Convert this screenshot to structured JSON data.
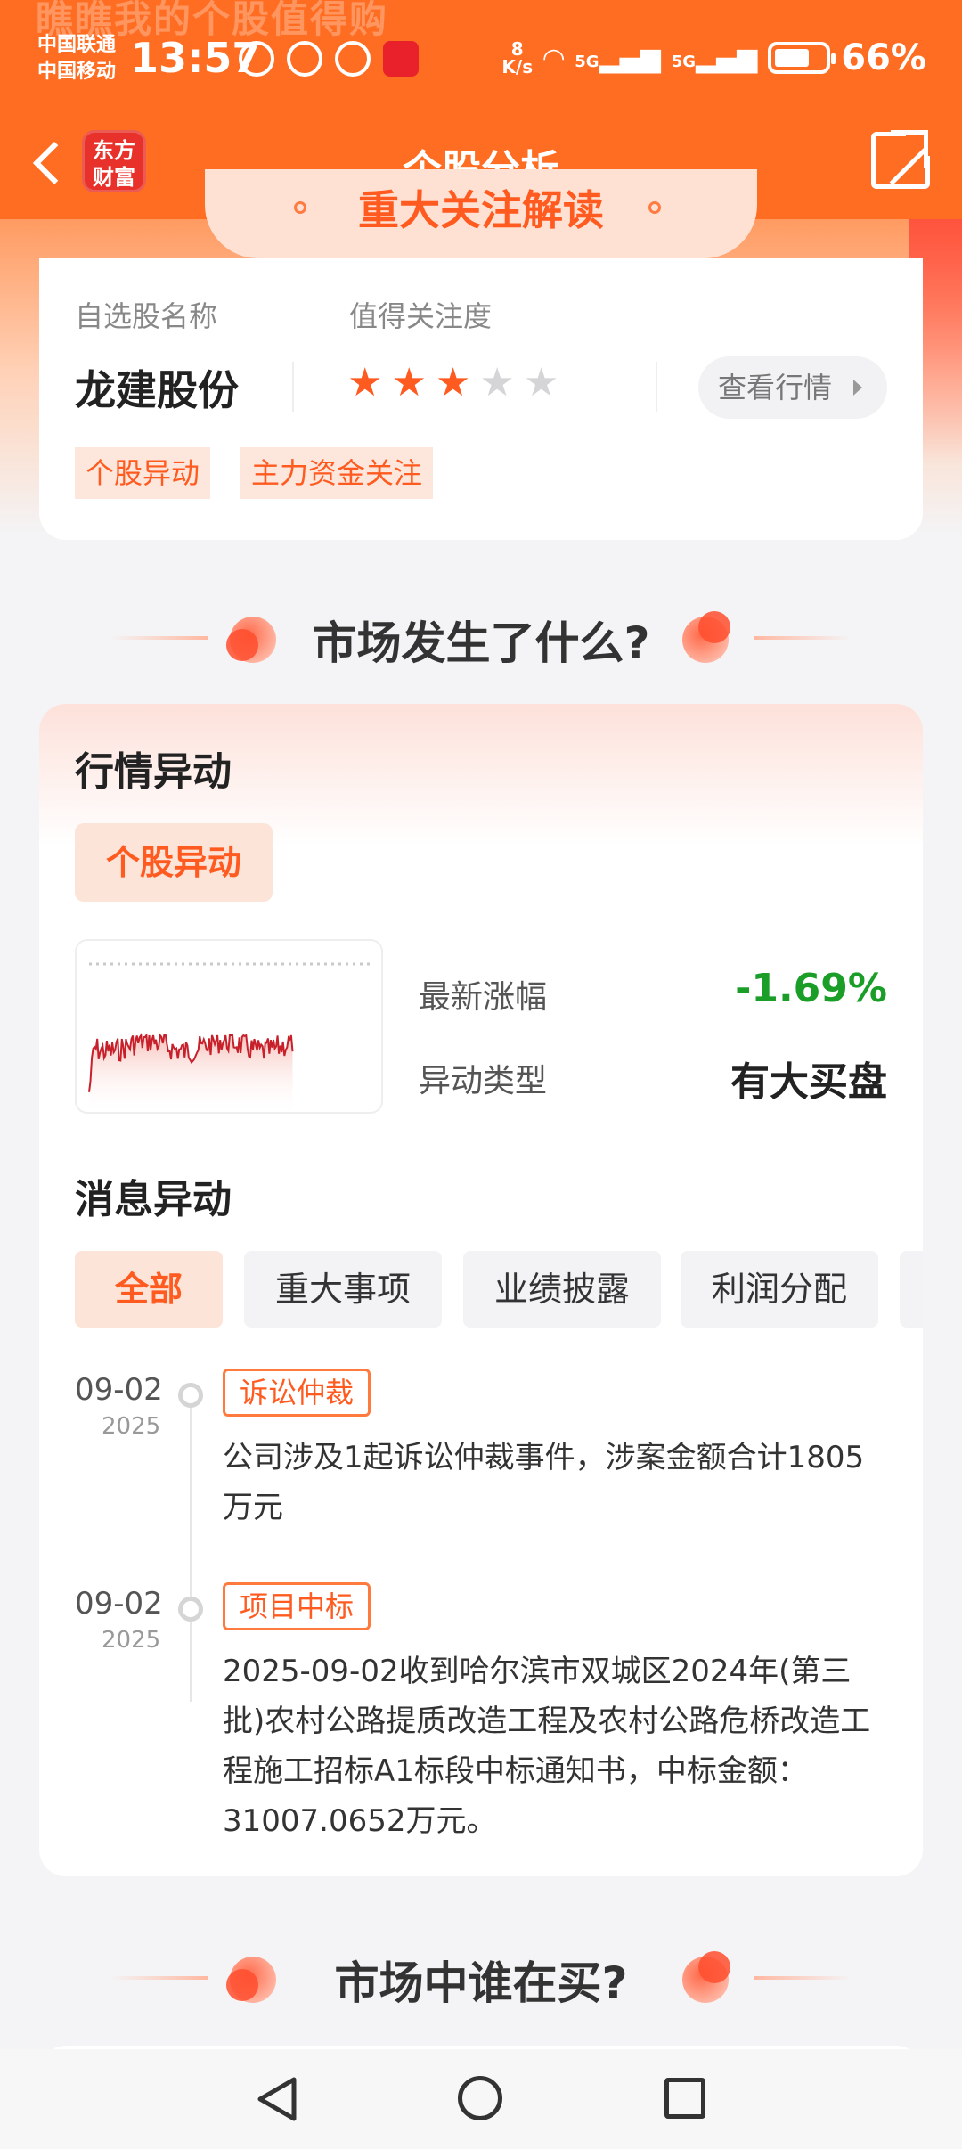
{
  "banner_text": "瞧瞧我的个股值得购",
  "status_bar": {
    "carrier1": "中国联通",
    "carrier2": "中国移动",
    "time": "13:57",
    "net_speed": "8",
    "net_speed_unit": "K/s",
    "sig1": "5G",
    "sig2": "5G",
    "battery": "66%"
  },
  "nav": {
    "logo_line1": "东方",
    "logo_line2": "财富",
    "title": "个股分析"
  },
  "highlight_title": "重大关注解读",
  "summary": {
    "name_label": "自选股名称",
    "attention_label": "值得关注度",
    "stock_name": "龙建股份",
    "stars_total": 5,
    "stars_filled": 3,
    "view_button": "查看行情",
    "tags": [
      "个股异动",
      "主力资金关注"
    ]
  },
  "section1_title": "市场发生了什么?",
  "market": {
    "title": "行情异动",
    "chip": "个股异动",
    "latest_change_label": "最新涨幅",
    "latest_change_value": "-1.69%",
    "anomaly_type_label": "异动类型",
    "anomaly_type_value": "有大买盘",
    "colors": {
      "down": "#1a9e28",
      "accent": "#ff5a1f"
    }
  },
  "news": {
    "title": "消息异动",
    "filters": [
      "全部",
      "重大事项",
      "业绩披露",
      "利润分配",
      ""
    ],
    "active_filter": 0,
    "items": [
      {
        "date": "09-02",
        "year": "2025",
        "tag": "诉讼仲裁",
        "text": "公司涉及1起诉讼仲裁事件，涉案金额合计1805万元"
      },
      {
        "date": "09-02",
        "year": "2025",
        "tag": "项目中标",
        "text": "2025-09-02收到哈尔滨市双城区2024年(第三批)农村公路提质改造工程及农村公路危桥改造工程施工招标A1标段中标通知书，中标金额：31007.0652万元。"
      }
    ]
  },
  "section2_title": "市场中谁在买?"
}
